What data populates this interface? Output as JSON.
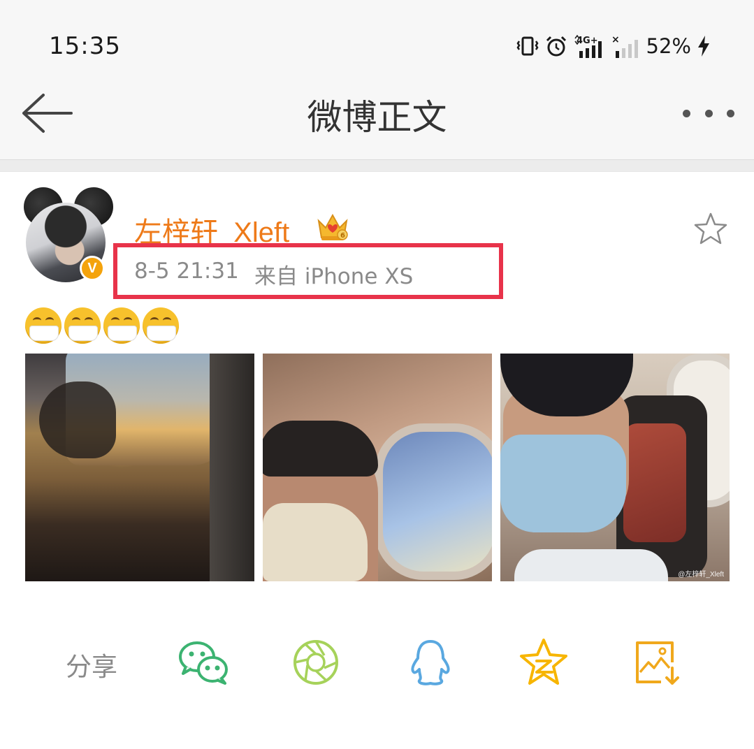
{
  "status_bar": {
    "time": "15:35",
    "battery": "52%",
    "icons": [
      "vibrate-icon",
      "alarm-icon",
      "signal-4g-icon",
      "signal-no-sim-icon",
      "charging-icon"
    ]
  },
  "nav": {
    "title": "微博正文",
    "back_icon": "back-arrow-icon",
    "more_icon": "more-dots-icon"
  },
  "post": {
    "username": "左梓轩_Xleft",
    "username_color": "#ee7a19",
    "badge_icon": "crown-icon",
    "verified_icon": "verified-v-icon",
    "time": "8-5 21:31",
    "source": "来自 iPhone XS",
    "highlight_color": "#e8334a",
    "emoji_text": [
      "mask-face-emoji",
      "mask-face-emoji",
      "mask-face-emoji",
      "mask-face-emoji"
    ],
    "images": [
      {
        "desc": "sunset-plane-window-photo"
      },
      {
        "desc": "selfie-plane-window-photo"
      },
      {
        "desc": "selfie-mask-seat-photo",
        "watermark": "@左梓轩_Xleft"
      }
    ]
  },
  "share": {
    "label": "分享",
    "targets": [
      {
        "name": "wechat",
        "icon": "wechat-icon",
        "color": "#3cb371"
      },
      {
        "name": "moments",
        "icon": "moments-aperture-icon",
        "color": "#a6d25a"
      },
      {
        "name": "qq",
        "icon": "qq-penguin-icon",
        "color": "#5aa8e0"
      },
      {
        "name": "qzone",
        "icon": "qzone-star-icon",
        "color": "#f7b500"
      },
      {
        "name": "save-image",
        "icon": "save-image-icon",
        "color": "#f0a81c"
      }
    ]
  }
}
